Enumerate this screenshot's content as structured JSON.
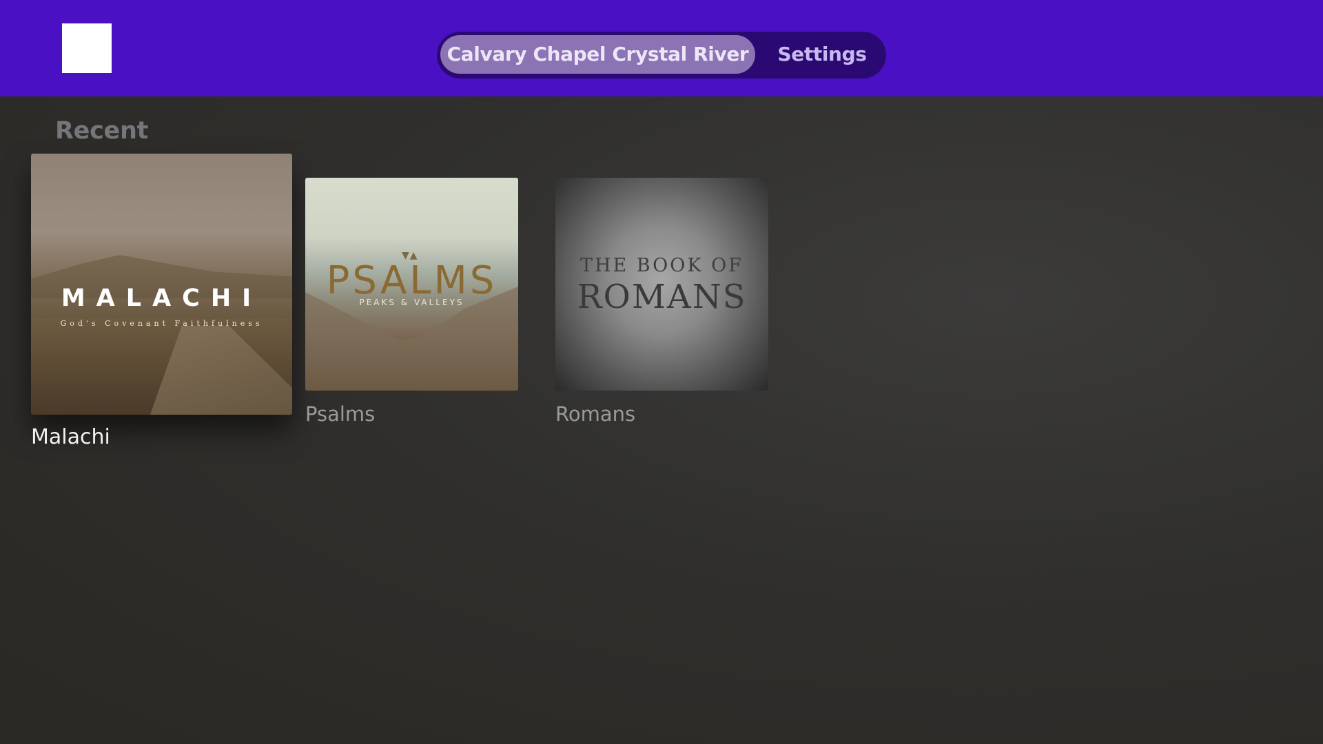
{
  "header": {
    "tabs": [
      {
        "label": "Calvary Chapel Crystal River",
        "selected": true
      },
      {
        "label": "Settings",
        "selected": false
      }
    ],
    "colors": {
      "bar": "#4a10c4",
      "tab_bg": "#2a0a72",
      "tab_selected": "#8c73b4"
    }
  },
  "recent": {
    "title": "Recent",
    "items": [
      {
        "label": "Malachi",
        "focused": true,
        "art": {
          "title": "MALACHI",
          "subtitle": "God's Covenant Faithfulness"
        }
      },
      {
        "label": "Psalms",
        "focused": false,
        "art": {
          "title": "PSALMS",
          "subtitle": "PEAKS & VALLEYS"
        }
      },
      {
        "label": "Romans",
        "focused": false,
        "art": {
          "line1": "THE BOOK OF",
          "line2": "ROMANS"
        }
      }
    ]
  }
}
